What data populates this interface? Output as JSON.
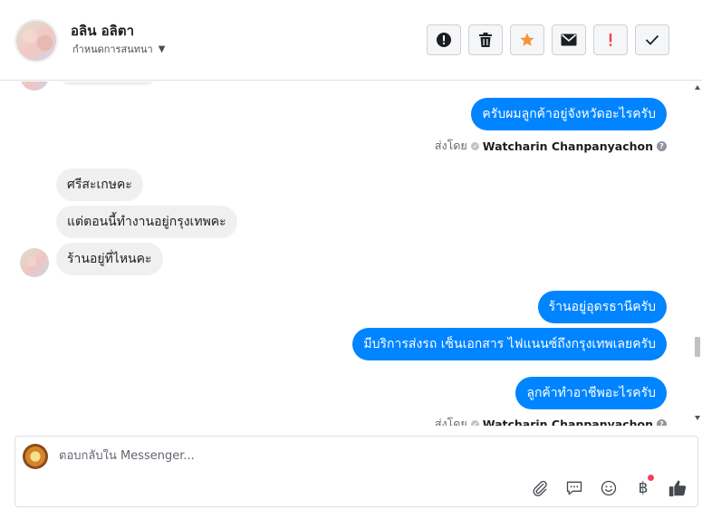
{
  "header": {
    "contact_name": "อลิน อลิตา",
    "assign_label": "กำหนดการสนทนา",
    "actions": [
      {
        "name": "spam",
        "icon": "exclamation-circle-icon"
      },
      {
        "name": "delete",
        "icon": "trash-icon"
      },
      {
        "name": "star",
        "icon": "star-icon",
        "color": "#f7923b"
      },
      {
        "name": "mark-unread",
        "icon": "envelope-icon"
      },
      {
        "name": "important",
        "icon": "exclamation-icon",
        "color": "#fa3e3e"
      },
      {
        "name": "done",
        "icon": "check-icon"
      }
    ]
  },
  "thread": {
    "messages": [
      {
        "from": "page",
        "text": "ครับผมลูกค้าอยู่จังหวัดอะไรครับ"
      },
      {
        "from": "contact",
        "text": "ศรีสะเกษคะ"
      },
      {
        "from": "contact",
        "text": "แต่ตอนนี้ทำงานอยู่กรุงเทพคะ"
      },
      {
        "from": "contact",
        "text": "ร้านอยู่ที่ไหนคะ"
      },
      {
        "from": "page",
        "text": "ร้านอยู่อุดรธานีครับ"
      },
      {
        "from": "page",
        "text": "มีบริการส่งรถ เซ็นเอกสาร ไฟแนนซ์ถึงกรุงเทพเลยครับ"
      },
      {
        "from": "page",
        "text": "ลูกค้าทำอาชีพอะไรครับ"
      }
    ],
    "sent_by_prefix": "ส่งโดย",
    "sent_by_name": "Watcharin Chanpanyachon"
  },
  "composer": {
    "placeholder": "ตอบกลับใน Messenger...",
    "currency_symbol": "฿",
    "tools": [
      "paperclip-icon",
      "speech-bubble-icon",
      "smiley-icon",
      "baht-icon",
      "thumbs-up-icon"
    ]
  },
  "colors": {
    "outgoing_bubble": "#0084ff",
    "incoming_bubble": "#f1f0f0",
    "star": "#f7923b",
    "important": "#fa3e3e"
  }
}
